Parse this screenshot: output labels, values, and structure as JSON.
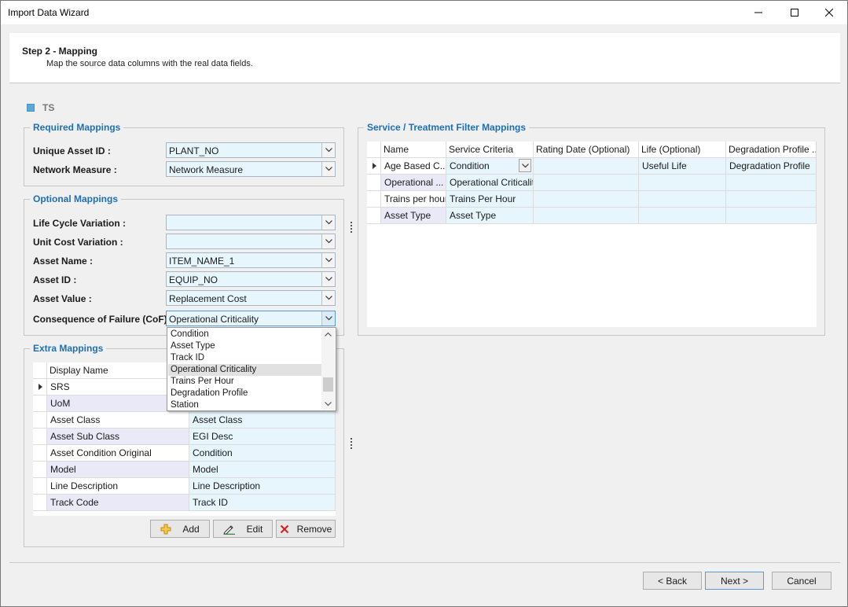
{
  "window": {
    "title": "Import Data Wizard"
  },
  "step": {
    "title": "Step 2 - Mapping",
    "subtitle": "Map the source data columns with the real data fields."
  },
  "ts_label": "TS",
  "required": {
    "title": "Required Mappings",
    "fields": [
      {
        "label": "Unique Asset ID :",
        "value": "PLANT_NO"
      },
      {
        "label": "Network Measure :",
        "value": "Network Measure"
      }
    ]
  },
  "optional": {
    "title": "Optional Mappings",
    "fields": [
      {
        "label": "Life Cycle Variation :",
        "value": ""
      },
      {
        "label": "Unit Cost Variation :",
        "value": ""
      },
      {
        "label": "Asset Name :",
        "value": "ITEM_NAME_1"
      },
      {
        "label": "Asset ID :",
        "value": "EQUIP_NO"
      },
      {
        "label": "Asset Value :",
        "value": "Replacement Cost"
      },
      {
        "label": "Consequence of Failure (CoF):",
        "value": "Operational Criticality"
      }
    ]
  },
  "dropdown": {
    "options": [
      "Condition",
      "Asset Type",
      "Track ID",
      "Operational Criticality",
      "Trains Per Hour",
      "Degradation Profile",
      "Station"
    ],
    "selected": "Operational Criticality"
  },
  "extra": {
    "title": "Extra Mappings",
    "header": "Display Name",
    "rows": [
      {
        "display": "SRS",
        "value": ""
      },
      {
        "display": "UoM",
        "value": ""
      },
      {
        "display": "Asset Class",
        "value": "Asset Class"
      },
      {
        "display": "Asset Sub Class",
        "value": "EGI Desc"
      },
      {
        "display": "Asset Condition Original",
        "value": "Condition"
      },
      {
        "display": "Model",
        "value": "Model"
      },
      {
        "display": "Line Description",
        "value": "Line Description"
      },
      {
        "display": "Track Code",
        "value": "Track ID"
      }
    ],
    "buttons": {
      "add": "Add",
      "edit": "Edit",
      "remove": "Remove"
    }
  },
  "service": {
    "title": "Service / Treatment Filter Mappings",
    "headers": [
      "Name",
      "Service Criteria",
      "Rating Date (Optional)",
      "Life (Optional)",
      "Degradation Profile ..."
    ],
    "rows": [
      [
        "Age Based C...",
        "Condition",
        "",
        "Useful Life",
        "Degradation Profile"
      ],
      [
        "Operational ...",
        "Operational Criticality",
        "",
        "",
        ""
      ],
      [
        "Trains per hour",
        "Trains Per Hour",
        "",
        "",
        ""
      ],
      [
        "Asset Type",
        "Asset Type",
        "",
        "",
        ""
      ]
    ]
  },
  "nav": {
    "back": "< Back",
    "next": "Next >",
    "cancel": "Cancel"
  },
  "colors": {
    "accent": "#1f6fb3",
    "field_bg": "#e6f6fc",
    "alt_row": "#e9e9f7"
  }
}
